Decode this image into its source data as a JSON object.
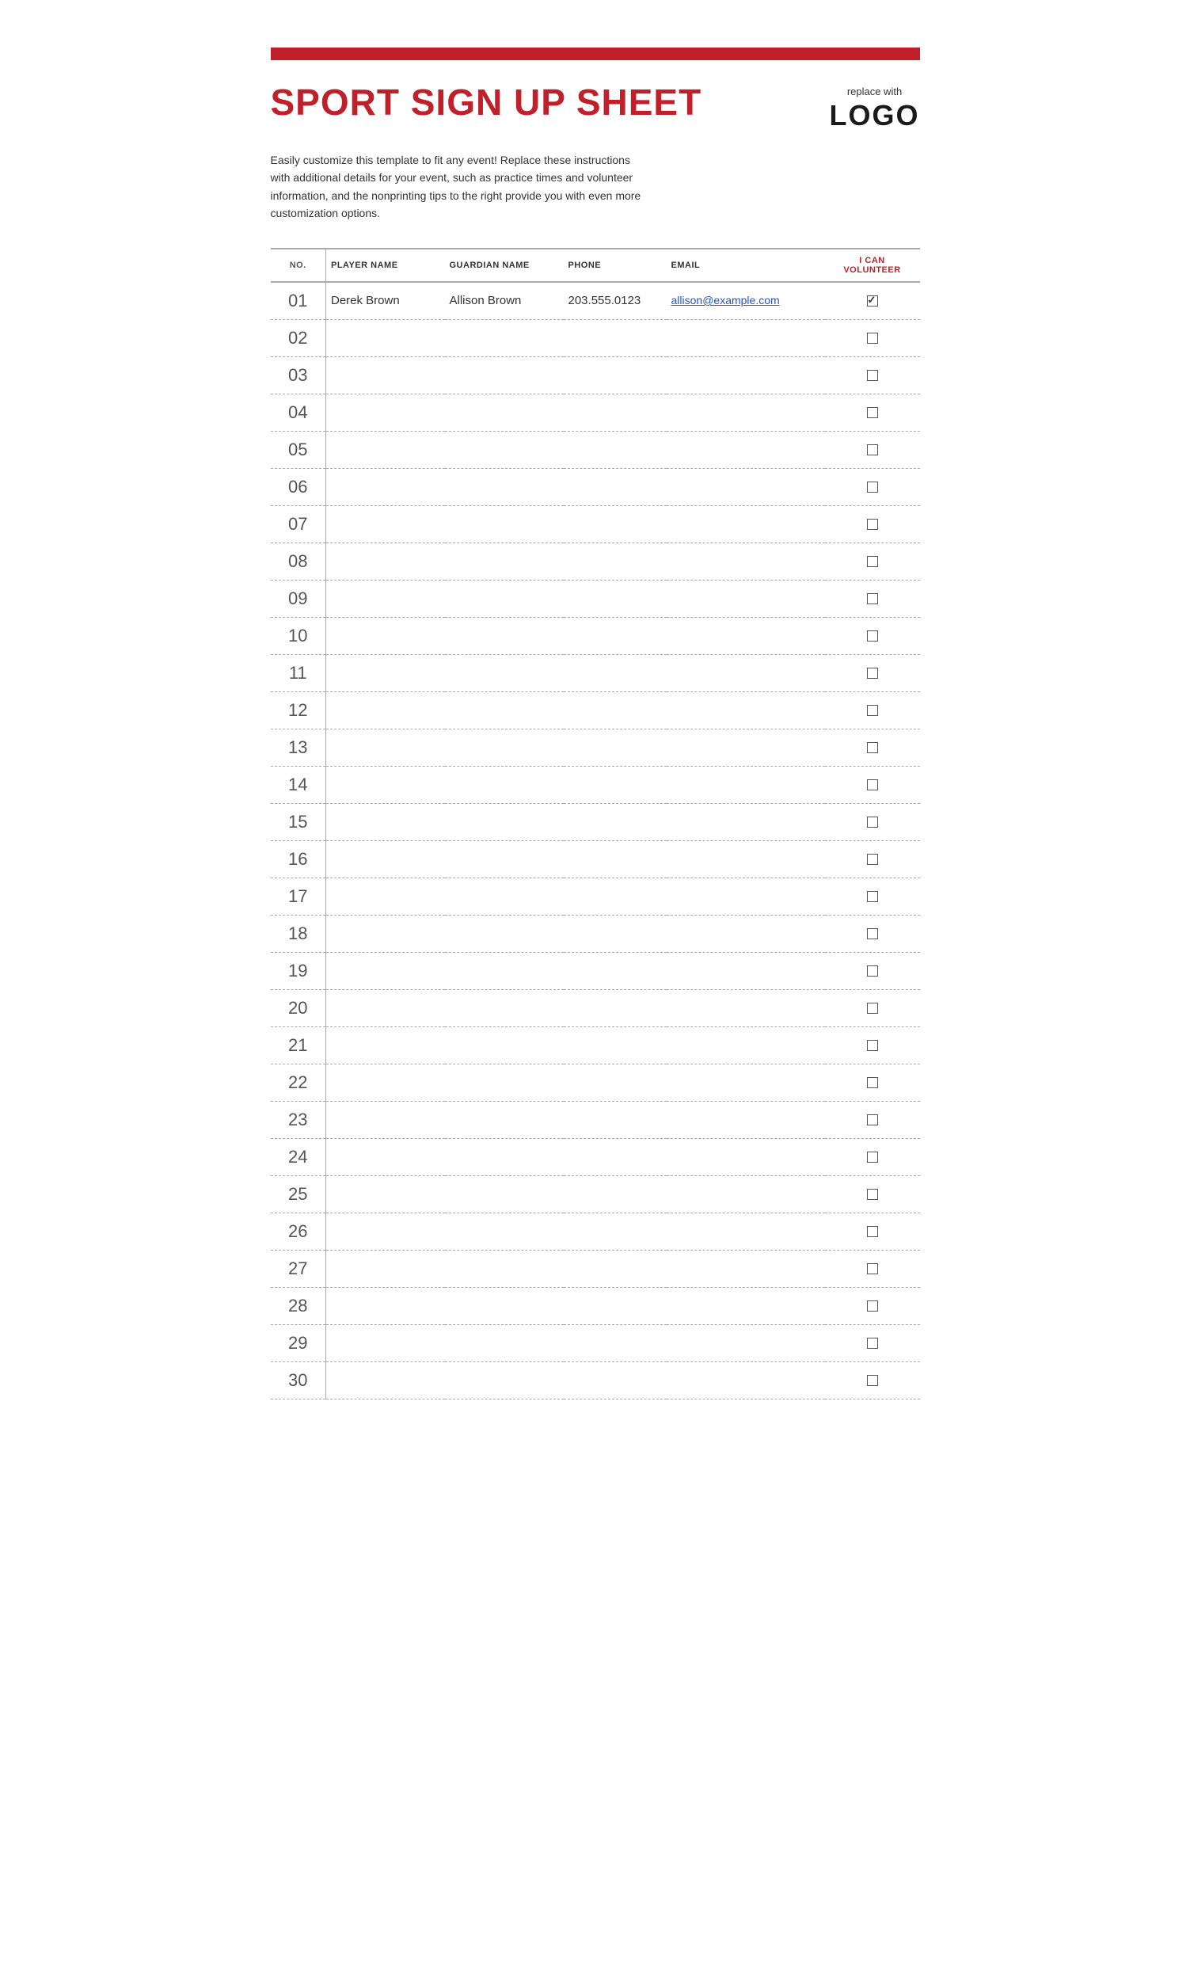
{
  "page": {
    "red_bar": "",
    "title": "SPORT SIGN UP SHEET",
    "logo": {
      "replace_text": "replace with",
      "logo_text": "LOGO"
    },
    "description": "Easily customize this template to fit any event! Replace these instructions with additional details for your event, such as practice times and volunteer information, and the nonprinting tips to the right provide you with even more customization options.",
    "table": {
      "headers": {
        "no": "NO.",
        "player_name": "PLAYER NAME",
        "guardian_name": "GUARDIAN NAME",
        "phone": "PHONE",
        "email": "EMAIL",
        "volunteer": "I CAN VOLUNTEER"
      },
      "rows": [
        {
          "no": "01",
          "player": "Derek Brown",
          "guardian": "Allison Brown",
          "phone": "203.555.0123",
          "email": "allison@example.com",
          "volunteer": true
        },
        {
          "no": "02",
          "player": "",
          "guardian": "",
          "phone": "",
          "email": "",
          "volunteer": false
        },
        {
          "no": "03",
          "player": "",
          "guardian": "",
          "phone": "",
          "email": "",
          "volunteer": false
        },
        {
          "no": "04",
          "player": "",
          "guardian": "",
          "phone": "",
          "email": "",
          "volunteer": false
        },
        {
          "no": "05",
          "player": "",
          "guardian": "",
          "phone": "",
          "email": "",
          "volunteer": false
        },
        {
          "no": "06",
          "player": "",
          "guardian": "",
          "phone": "",
          "email": "",
          "volunteer": false
        },
        {
          "no": "07",
          "player": "",
          "guardian": "",
          "phone": "",
          "email": "",
          "volunteer": false
        },
        {
          "no": "08",
          "player": "",
          "guardian": "",
          "phone": "",
          "email": "",
          "volunteer": false
        },
        {
          "no": "09",
          "player": "",
          "guardian": "",
          "phone": "",
          "email": "",
          "volunteer": false
        },
        {
          "no": "10",
          "player": "",
          "guardian": "",
          "phone": "",
          "email": "",
          "volunteer": false
        },
        {
          "no": "11",
          "player": "",
          "guardian": "",
          "phone": "",
          "email": "",
          "volunteer": false
        },
        {
          "no": "12",
          "player": "",
          "guardian": "",
          "phone": "",
          "email": "",
          "volunteer": false
        },
        {
          "no": "13",
          "player": "",
          "guardian": "",
          "phone": "",
          "email": "",
          "volunteer": false
        },
        {
          "no": "14",
          "player": "",
          "guardian": "",
          "phone": "",
          "email": "",
          "volunteer": false
        },
        {
          "no": "15",
          "player": "",
          "guardian": "",
          "phone": "",
          "email": "",
          "volunteer": false
        },
        {
          "no": "16",
          "player": "",
          "guardian": "",
          "phone": "",
          "email": "",
          "volunteer": false
        },
        {
          "no": "17",
          "player": "",
          "guardian": "",
          "phone": "",
          "email": "",
          "volunteer": false
        },
        {
          "no": "18",
          "player": "",
          "guardian": "",
          "phone": "",
          "email": "",
          "volunteer": false
        },
        {
          "no": "19",
          "player": "",
          "guardian": "",
          "phone": "",
          "email": "",
          "volunteer": false
        },
        {
          "no": "20",
          "player": "",
          "guardian": "",
          "phone": "",
          "email": "",
          "volunteer": false
        },
        {
          "no": "21",
          "player": "",
          "guardian": "",
          "phone": "",
          "email": "",
          "volunteer": false
        },
        {
          "no": "22",
          "player": "",
          "guardian": "",
          "phone": "",
          "email": "",
          "volunteer": false
        },
        {
          "no": "23",
          "player": "",
          "guardian": "",
          "phone": "",
          "email": "",
          "volunteer": false
        },
        {
          "no": "24",
          "player": "",
          "guardian": "",
          "phone": "",
          "email": "",
          "volunteer": false
        },
        {
          "no": "25",
          "player": "",
          "guardian": "",
          "phone": "",
          "email": "",
          "volunteer": false
        },
        {
          "no": "26",
          "player": "",
          "guardian": "",
          "phone": "",
          "email": "",
          "volunteer": false
        },
        {
          "no": "27",
          "player": "",
          "guardian": "",
          "phone": "",
          "email": "",
          "volunteer": false
        },
        {
          "no": "28",
          "player": "",
          "guardian": "",
          "phone": "",
          "email": "",
          "volunteer": false
        },
        {
          "no": "29",
          "player": "",
          "guardian": "",
          "phone": "",
          "email": "",
          "volunteer": false
        },
        {
          "no": "30",
          "player": "",
          "guardian": "",
          "phone": "",
          "email": "",
          "volunteer": false
        }
      ]
    }
  }
}
